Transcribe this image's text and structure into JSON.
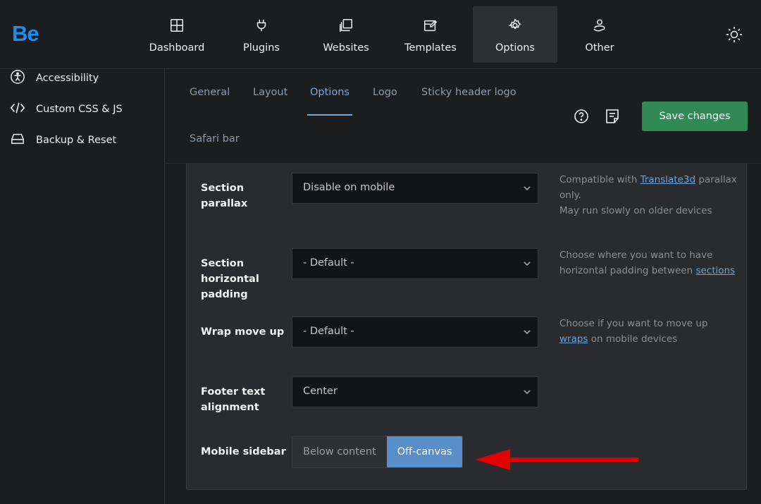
{
  "app": {
    "logo": "Be"
  },
  "nav": [
    {
      "label": "Dashboard",
      "icon": "dashboard-icon"
    },
    {
      "label": "Plugins",
      "icon": "plug-icon"
    },
    {
      "label": "Websites",
      "icon": "websites-icon"
    },
    {
      "label": "Templates",
      "icon": "templates-icon"
    },
    {
      "label": "Options",
      "icon": "gear-icon",
      "active": true
    },
    {
      "label": "Other",
      "icon": "user-hand-icon"
    }
  ],
  "sidebar": {
    "items": [
      {
        "label": "Accessibility",
        "icon": "accessibility-icon"
      },
      {
        "label": "Custom CSS & JS",
        "icon": "code-icon"
      },
      {
        "label": "Backup & Reset",
        "icon": "drive-icon"
      }
    ]
  },
  "tabs": {
    "items": [
      "General",
      "Layout",
      "Options",
      "Logo",
      "Sticky header logo",
      "Safari bar"
    ],
    "active": "Options"
  },
  "toolbar": {
    "save_label": "Save changes"
  },
  "settings": {
    "section_parallax": {
      "label": "Section parallax",
      "value": "Disable on mobile",
      "help_pre": "Compatible with ",
      "help_link": "Translate3d",
      "help_post": " parallax only.",
      "help_line2": "May run slowly on older devices"
    },
    "section_padding": {
      "label": "Section horizontal padding",
      "value": "- Default -",
      "help_pre": "Choose where you want to have horizontal padding between ",
      "help_link": "sections"
    },
    "wrap_move_up": {
      "label": "Wrap move up",
      "value": "- Default -",
      "help_pre": "Choose if you want to move up ",
      "help_link": "wraps",
      "help_post": " on mobile devices"
    },
    "footer_align": {
      "label": "Footer text alignment",
      "value": "Center"
    },
    "mobile_sidebar": {
      "label": "Mobile sidebar",
      "options": [
        "Below content",
        "Off-canvas"
      ],
      "selected": "Off-canvas"
    }
  },
  "colors": {
    "accent": "#79a9da",
    "save_button": "#2f8a53",
    "segment_selected": "#5a8ec8",
    "annotation_arrow": "#e00000",
    "logo": "#1e8cf0"
  }
}
